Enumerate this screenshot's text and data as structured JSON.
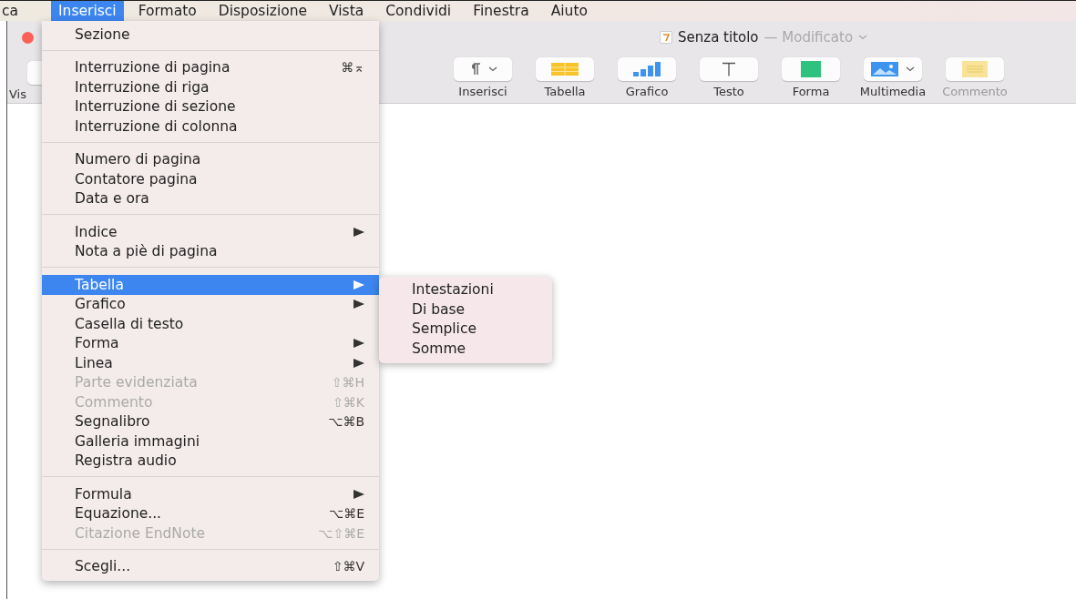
{
  "menu_bar": [
    {
      "label": "ca",
      "selected": false
    },
    {
      "label": "Inserisci",
      "selected": true
    },
    {
      "label": "Formato",
      "selected": false
    },
    {
      "label": "Disposizione",
      "selected": false
    },
    {
      "label": "Vista",
      "selected": false
    },
    {
      "label": "Condividi",
      "selected": false
    },
    {
      "label": "Finestra",
      "selected": false
    },
    {
      "label": "Aiuto",
      "selected": false
    }
  ],
  "window": {
    "title": "Senza titolo",
    "status": "— Modificato"
  },
  "toolbar": {
    "left_label": "Vis",
    "items": [
      {
        "label": "Inserisci",
        "kind": "pilcrow",
        "dropdown": true,
        "disabled": false
      },
      {
        "label": "Tabella",
        "kind": "table",
        "dropdown": false,
        "disabled": false
      },
      {
        "label": "Grafico",
        "kind": "chart",
        "dropdown": false,
        "disabled": false
      },
      {
        "label": "Testo",
        "kind": "text",
        "dropdown": false,
        "disabled": false
      },
      {
        "label": "Forma",
        "kind": "shape",
        "dropdown": false,
        "disabled": false
      },
      {
        "label": "Multimedia",
        "kind": "media",
        "dropdown": true,
        "disabled": false
      },
      {
        "label": "Commento",
        "kind": "comment",
        "dropdown": false,
        "disabled": true
      }
    ]
  },
  "menu": {
    "groups": [
      [
        {
          "label": "Sezione",
          "submenu": false,
          "disabled": false,
          "selected": false
        }
      ],
      [
        {
          "label": "Interruzione di pagina",
          "shortcut": "⌘⌅",
          "submenu": false,
          "disabled": false,
          "selected": false
        },
        {
          "label": "Interruzione di riga",
          "submenu": false,
          "disabled": false,
          "selected": false
        },
        {
          "label": "Interruzione di sezione",
          "submenu": false,
          "disabled": false,
          "selected": false
        },
        {
          "label": "Interruzione di colonna",
          "submenu": false,
          "disabled": false,
          "selected": false
        }
      ],
      [
        {
          "label": "Numero di pagina",
          "submenu": false,
          "disabled": false,
          "selected": false
        },
        {
          "label": "Contatore pagina",
          "submenu": false,
          "disabled": false,
          "selected": false
        },
        {
          "label": "Data e ora",
          "submenu": false,
          "disabled": false,
          "selected": false
        }
      ],
      [
        {
          "label": "Indice",
          "submenu": true,
          "disabled": false,
          "selected": false
        },
        {
          "label": "Nota a piè di pagina",
          "submenu": false,
          "disabled": false,
          "selected": false
        }
      ],
      [
        {
          "label": "Tabella",
          "submenu": true,
          "disabled": false,
          "selected": true
        },
        {
          "label": "Grafico",
          "submenu": true,
          "disabled": false,
          "selected": false
        },
        {
          "label": "Casella di testo",
          "submenu": false,
          "disabled": false,
          "selected": false
        },
        {
          "label": "Forma",
          "submenu": true,
          "disabled": false,
          "selected": false
        },
        {
          "label": "Linea",
          "submenu": true,
          "disabled": false,
          "selected": false
        },
        {
          "label": "Parte evidenziata",
          "shortcut": "⇧⌘H",
          "submenu": false,
          "disabled": true,
          "selected": false
        },
        {
          "label": "Commento",
          "shortcut": "⇧⌘K",
          "submenu": false,
          "disabled": true,
          "selected": false
        },
        {
          "label": "Segnalibro",
          "shortcut": "⌥⌘B",
          "submenu": false,
          "disabled": false,
          "selected": false
        },
        {
          "label": "Galleria immagini",
          "submenu": false,
          "disabled": false,
          "selected": false
        },
        {
          "label": "Registra audio",
          "submenu": false,
          "disabled": false,
          "selected": false
        }
      ],
      [
        {
          "label": "Formula",
          "submenu": true,
          "disabled": false,
          "selected": false
        },
        {
          "label": "Equazione...",
          "shortcut": "⌥⌘E",
          "submenu": false,
          "disabled": false,
          "selected": false
        },
        {
          "label": "Citazione EndNote",
          "shortcut": "⌥⇧⌘E",
          "submenu": false,
          "disabled": true,
          "selected": false
        }
      ],
      [
        {
          "label": "Scegli...",
          "shortcut": "⇧⌘V",
          "submenu": false,
          "disabled": false,
          "selected": false
        }
      ]
    ]
  },
  "submenu": {
    "items": [
      "Intestazioni",
      "Di base",
      "Semplice",
      "Somme"
    ]
  }
}
